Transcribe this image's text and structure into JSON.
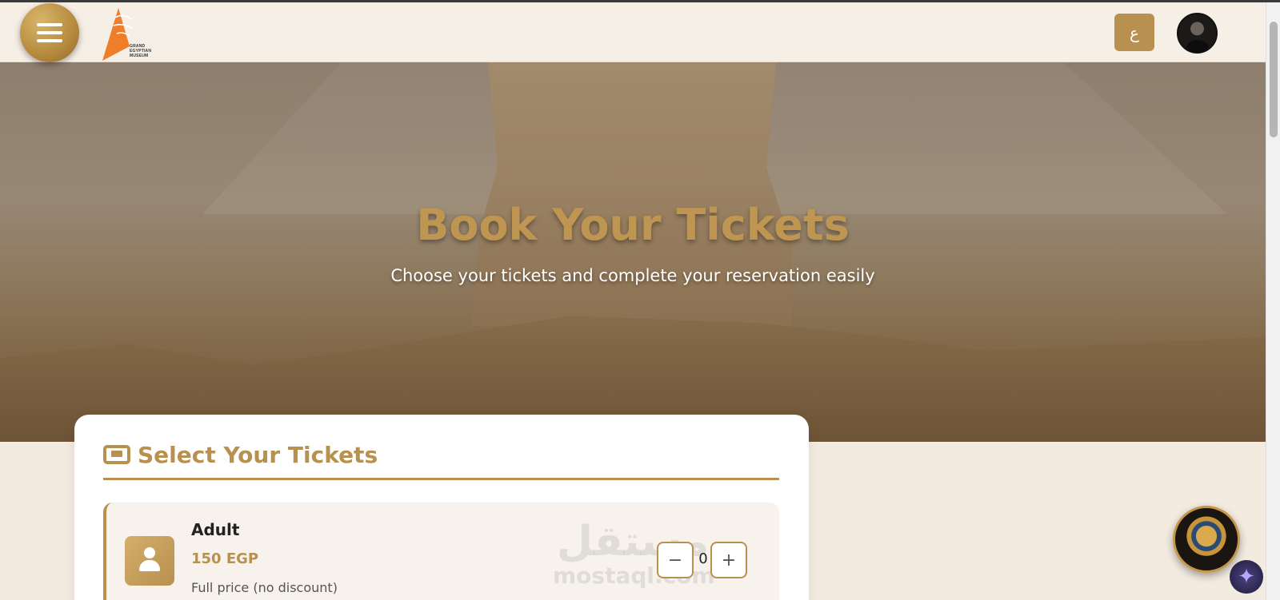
{
  "header": {
    "logo_text_lines": [
      "GRAND",
      "EGYPTIAN",
      "MUSEUM"
    ],
    "language_button_label": "ع"
  },
  "hero": {
    "title": "Book Your Tickets",
    "subtitle": "Choose your tickets and complete your reservation easily"
  },
  "tickets_card": {
    "title": "Select Your Tickets",
    "tickets": [
      {
        "name": "Adult",
        "price": "150 EGP",
        "description": "Full price (no discount)",
        "quantity": "0",
        "minus_label": "−",
        "plus_label": "+"
      }
    ]
  },
  "watermark": {
    "arabic": "مستقل",
    "latin": "mostaql.com"
  },
  "floating": {
    "sparkle_symbol": "✦"
  },
  "colors": {
    "accent": "#b8904f",
    "page_background": "#f3ebe0",
    "header_background": "#f6efe6"
  }
}
